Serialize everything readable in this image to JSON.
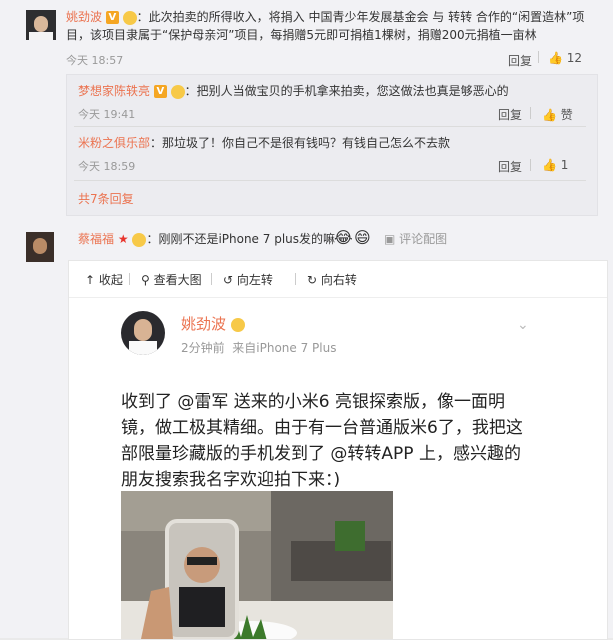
{
  "comment1": {
    "author": "姚劲波",
    "text": "：此次拍卖的所得收入，将捐入 中国青少年发展基金会 与 转转 合作的“闲置造林”项目，该项目隶属于“保护母亲河”项目，每捐赠5元即可捐植1棵树，捐赠200元捐植一亩林",
    "time": "今天 18:57",
    "reply_label": "回复",
    "like_count": "12",
    "replies": [
      {
        "author": "梦想家陈轶亮",
        "text": "：把别人当做宝贝的手机拿来拍卖，您这做法也真是够恶心的",
        "time": "今天 19:41",
        "reply_label": "回复",
        "like_label": "赞"
      },
      {
        "author": "米粉之俱乐部",
        "text": "：那垃圾了！你自己不是很有钱吗？有钱自己怎么不去款",
        "time": "今天 18:59",
        "reply_label": "回复",
        "like_count": "1"
      }
    ],
    "more_replies": "共7条回复"
  },
  "comment2": {
    "author": "蔡福福",
    "text": "：刚刚不还是iPhone 7 plus发的嘛",
    "view_image": "评论配图"
  },
  "card": {
    "toolbar": [
      "收起",
      "查看大图",
      "向左转",
      "向右转"
    ],
    "author": "姚劲波",
    "meta_time": "2分钟前",
    "meta_source": "来自iPhone 7 Plus",
    "post_lines": [
      "收到了 @雷军 送来的小米6 亮银探索版，像一面明",
      "镜，做工极其精细。由于有一台普通版米6了，我把这",
      "部限量珍藏版的手机发到了 @转转APP 上，感兴趣的",
      "朋友搜索我名字欢迎拍下来：)"
    ]
  },
  "colors": {
    "link": "#eb7350",
    "mention": "#1a6fb5",
    "badge": "#f5a623"
  }
}
